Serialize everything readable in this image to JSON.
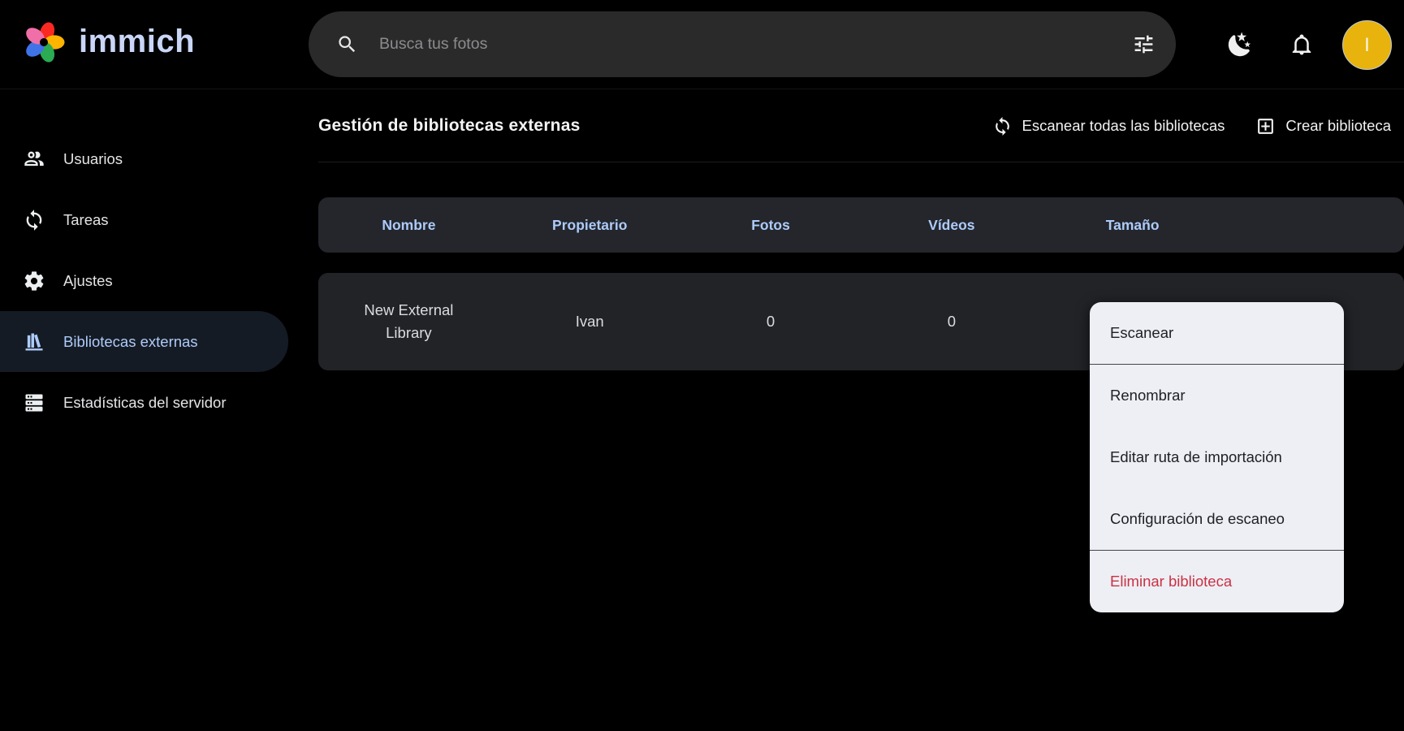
{
  "app": {
    "name": "immich"
  },
  "topbar": {
    "search_placeholder": "Busca tus fotos",
    "avatar_initial": "I",
    "icons": [
      "search-icon",
      "tune-icon",
      "dark-mode-moon-icon",
      "notifications-bell-icon"
    ]
  },
  "sidebar": {
    "items": [
      {
        "label": "Usuarios",
        "icon": "users-icon",
        "active": false
      },
      {
        "label": "Tareas",
        "icon": "sync-tasks-icon",
        "active": false
      },
      {
        "label": "Ajustes",
        "icon": "settings-gear-icon",
        "active": false
      },
      {
        "label": "Bibliotecas externas",
        "icon": "library-bookshelf-icon",
        "active": true
      },
      {
        "label": "Estadísticas del servidor",
        "icon": "server-stats-icon",
        "active": false
      }
    ]
  },
  "main": {
    "title": "Gestión de bibliotecas externas",
    "actions": [
      {
        "label": "Escanear todas las bibliotecas",
        "icon": "scan-refresh-icon"
      },
      {
        "label": "Crear biblioteca",
        "icon": "create-plus-box-icon"
      }
    ]
  },
  "table": {
    "columns": [
      "Nombre",
      "Propietario",
      "Fotos",
      "Vídeos",
      "Tamaño"
    ],
    "rows": [
      {
        "name": "New External Library",
        "owner": "Ivan",
        "photos": "0",
        "videos": "0"
      }
    ]
  },
  "context_menu": {
    "items": [
      {
        "label": "Escanear",
        "danger": false
      },
      {
        "label": "Renombrar",
        "danger": false
      },
      {
        "label": "Editar ruta de importación",
        "danger": false
      },
      {
        "label": "Configuración de escaneo",
        "danger": false
      },
      {
        "label": "Eliminar biblioteca",
        "danger": true
      }
    ]
  },
  "colors": {
    "accent": "#adcbfa",
    "danger": "#cb3144",
    "avatar_bg": "#e7b30c",
    "menu_bg": "#edeff4",
    "logo_petals": [
      "#fa2921",
      "#ffb400",
      "#2bab52",
      "#4073e8",
      "#f06fa9"
    ]
  }
}
